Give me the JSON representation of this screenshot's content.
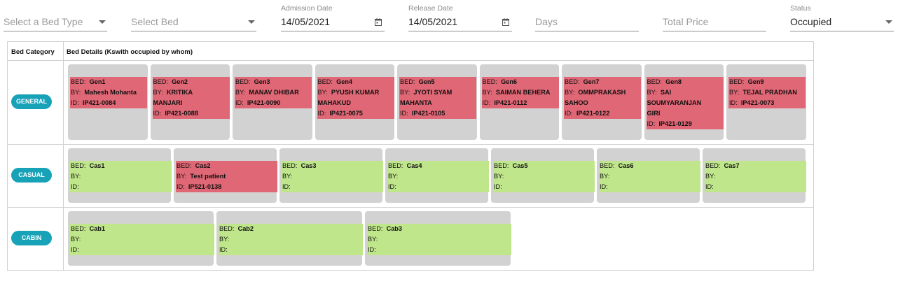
{
  "filters": {
    "bed_type": {
      "placeholder": "Select a Bed Type"
    },
    "bed": {
      "placeholder": "Select Bed"
    },
    "admission_date": {
      "label": "Admission Date",
      "value": "14/05/2021"
    },
    "release_date": {
      "label": "Release Date",
      "value": "14/05/2021"
    },
    "days": {
      "placeholder": "Days"
    },
    "total_price": {
      "placeholder": "Total Price"
    },
    "status": {
      "label": "Status",
      "value": "Occupied"
    }
  },
  "table": {
    "col_category": "Bed Category",
    "col_details": "Bed Details (Kswith occupied by whom)",
    "prefix_bed": "BED:",
    "prefix_by": "BY:",
    "prefix_id": "ID:"
  },
  "categories": [
    {
      "name": "GENERAL",
      "beds": [
        {
          "bed": "Gen1",
          "by": [
            "Mahesh Mohanta"
          ],
          "id": "IP421-0084",
          "occupied": true
        },
        {
          "bed": "Gen2",
          "by": [
            "KRITIKA",
            "MANJARI"
          ],
          "id": "IP421-0088",
          "occupied": true
        },
        {
          "bed": "Gen3",
          "by": [
            "MANAV DHIBAR"
          ],
          "id": "IP421-0090",
          "occupied": true
        },
        {
          "bed": "Gen4",
          "by": [
            "PYUSH KUMAR",
            "MAHAKUD"
          ],
          "id": "IP421-0075",
          "occupied": true
        },
        {
          "bed": "Gen5",
          "by": [
            "JYOTI SYAM",
            "MAHANTA"
          ],
          "id": "IP421-0105",
          "occupied": true
        },
        {
          "bed": "Gen6",
          "by": [
            "SAIMAN BEHERA"
          ],
          "id": "IP421-0112",
          "occupied": true
        },
        {
          "bed": "Gen7",
          "by": [
            "OMMPRAKASH",
            "SAHOO"
          ],
          "id": "IP421-0122",
          "occupied": true
        },
        {
          "bed": "Gen8",
          "by": [
            "SAI",
            "SOUMYARANJAN",
            "GIRI"
          ],
          "id": "IP421-0129",
          "occupied": true
        },
        {
          "bed": "Gen9",
          "by": [
            "TEJAL PRADHAN"
          ],
          "id": "IP421-0073",
          "occupied": true
        }
      ]
    },
    {
      "name": "CASUAL",
      "beds": [
        {
          "bed": "Cas1",
          "by": [
            ""
          ],
          "id": "",
          "occupied": false
        },
        {
          "bed": "Cas2",
          "by": [
            "Test patient"
          ],
          "id": "IP521-0138",
          "occupied": true
        },
        {
          "bed": "Cas3",
          "by": [
            ""
          ],
          "id": "",
          "occupied": false
        },
        {
          "bed": "Cas4",
          "by": [
            ""
          ],
          "id": "",
          "occupied": false
        },
        {
          "bed": "Cas5",
          "by": [
            ""
          ],
          "id": "",
          "occupied": false
        },
        {
          "bed": "Cas6",
          "by": [
            ""
          ],
          "id": "",
          "occupied": false
        },
        {
          "bed": "Cas7",
          "by": [
            ""
          ],
          "id": "",
          "occupied": false
        }
      ]
    },
    {
      "name": "CABIN",
      "beds": [
        {
          "bed": "Cab1",
          "by": [
            ""
          ],
          "id": "",
          "occupied": false
        },
        {
          "bed": "Cab2",
          "by": [
            ""
          ],
          "id": "",
          "occupied": false
        },
        {
          "bed": "Cab3",
          "by": [
            ""
          ],
          "id": "",
          "occupied": false
        }
      ]
    }
  ]
}
